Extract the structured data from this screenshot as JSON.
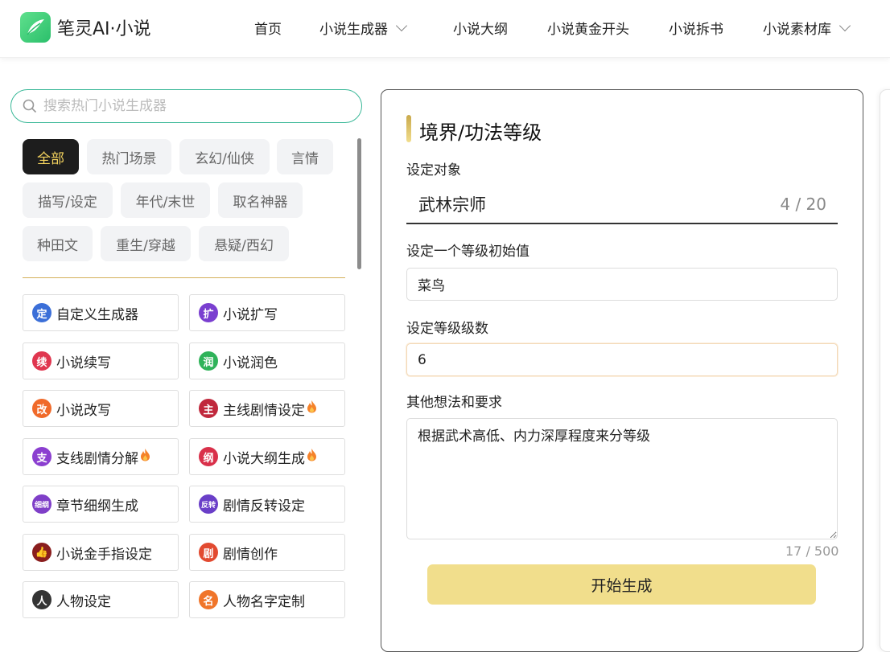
{
  "app": {
    "logo_text": "笔灵AI·小说"
  },
  "nav": [
    {
      "label": "首页"
    },
    {
      "label": "小说生成器",
      "dropdown": true
    },
    {
      "label": "小说大纲"
    },
    {
      "label": "小说黄金开头"
    },
    {
      "label": "小说拆书"
    },
    {
      "label": "小说素材库",
      "dropdown": true
    }
  ],
  "search": {
    "placeholder": "搜索热门小说生成器",
    "value": ""
  },
  "categories": [
    "全部",
    "热门场景",
    "玄幻/仙侠",
    "言情",
    "描写/设定",
    "年代/末世",
    "取名神器",
    "种田文",
    "重生/穿越",
    "悬疑/西幻"
  ],
  "active_category": "全部",
  "tools": [
    {
      "label": "自定义生成器",
      "icon": "定",
      "color": "#3b6fd8",
      "hot": false
    },
    {
      "label": "小说扩写",
      "icon": "扩",
      "color": "#7a3fd0",
      "hot": false
    },
    {
      "label": "小说续写",
      "icon": "续",
      "color": "#e0364f",
      "hot": false
    },
    {
      "label": "小说润色",
      "icon": "润",
      "color": "#2fb35a",
      "hot": false
    },
    {
      "label": "小说改写",
      "icon": "改",
      "color": "#f06a2a",
      "hot": false
    },
    {
      "label": "主线剧情设定",
      "icon": "主",
      "color": "#c0283c",
      "hot": true
    },
    {
      "label": "支线剧情分解",
      "icon": "支",
      "color": "#8b3fd0",
      "hot": true
    },
    {
      "label": "小说大纲生成",
      "icon": "纲",
      "color": "#d9304a",
      "hot": true
    },
    {
      "label": "章节细纲生成",
      "icon": "细纲",
      "color": "#7f3fc8",
      "hot": false
    },
    {
      "label": "剧情反转设定",
      "icon": "反转",
      "color": "#6a3fc8",
      "hot": false
    },
    {
      "label": "小说金手指设定",
      "icon": "👍",
      "color": "#8a1e1e",
      "hot": false
    },
    {
      "label": "剧情创作",
      "icon": "剧",
      "color": "#e24a30",
      "hot": false
    },
    {
      "label": "人物设定",
      "icon": "人",
      "color": "#333333",
      "hot": false
    },
    {
      "label": "人物名字定制",
      "icon": "名",
      "color": "#f0752a",
      "hot": false
    }
  ],
  "form": {
    "title": "境界/功法等级",
    "field1_label": "设定对象",
    "field1_value": "武林宗师",
    "field1_count": "4 / 20",
    "field2_label": "设定一个等级初始值",
    "field2_value": "菜鸟",
    "field3_label": "设定等级级数",
    "field3_value": "6",
    "field4_label": "其他想法和要求",
    "field4_value": "根据武术高低、内力深厚程度来分等级",
    "field4_count": "17 / 500",
    "submit_label": "开始生成"
  },
  "colors": {
    "accent_green": "#3ab898",
    "active_tab_text": "#f4d35e",
    "button_bg": "#f1de8c"
  }
}
